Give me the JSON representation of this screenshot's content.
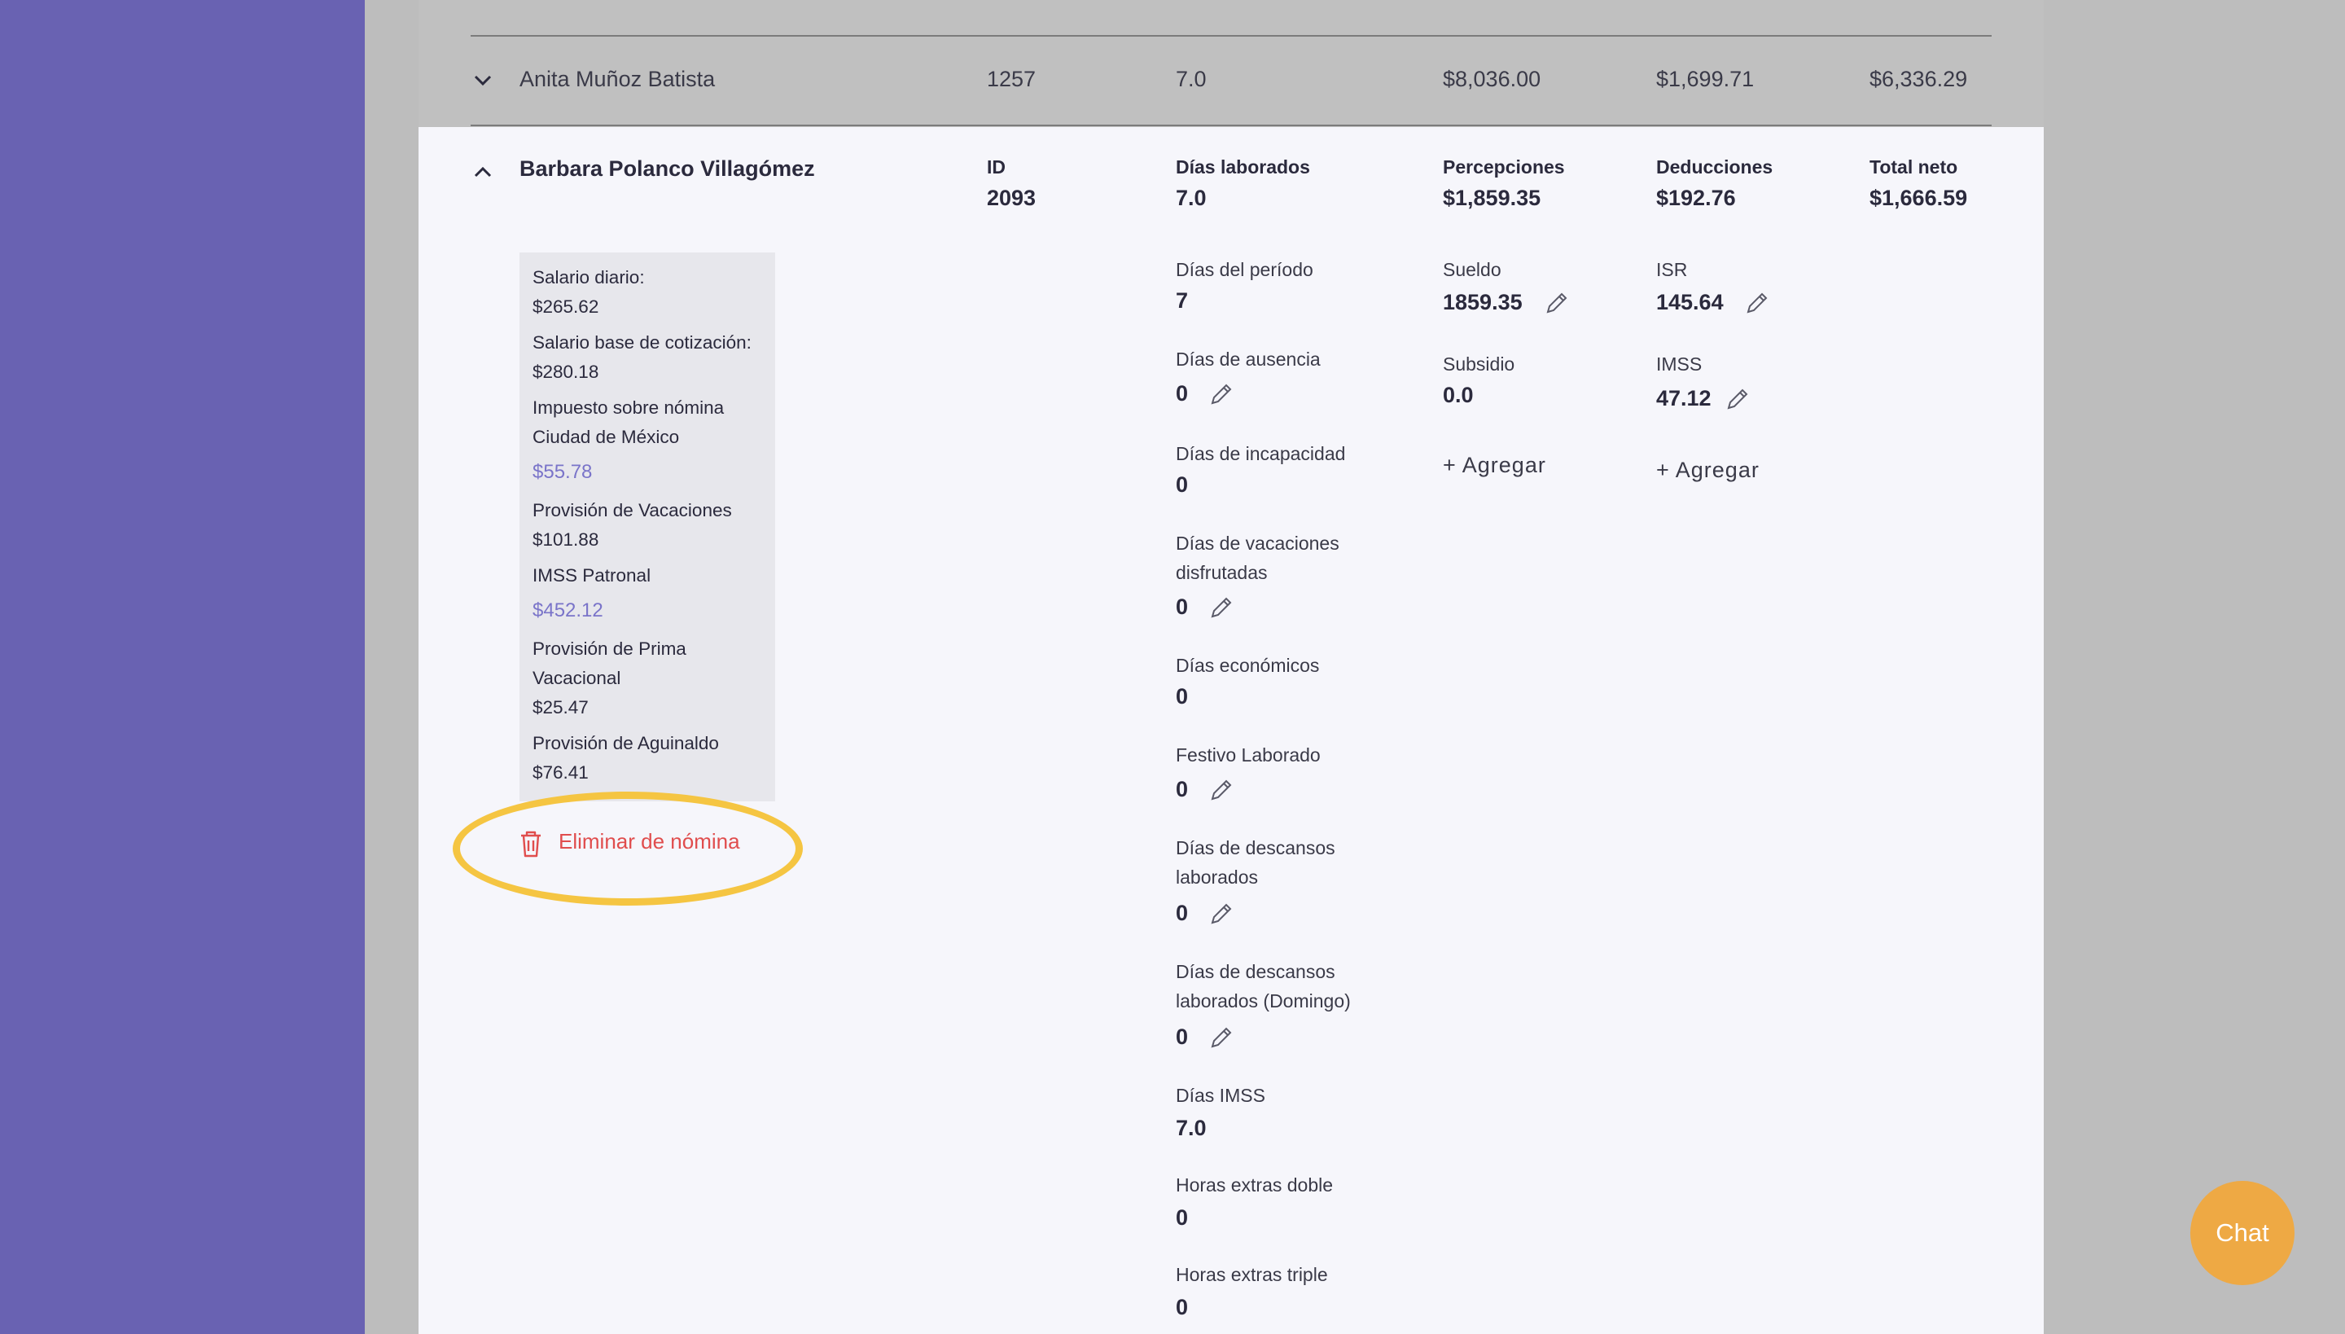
{
  "colors": {
    "sidebar": "#6962b2",
    "accent_link": "#7a74c9",
    "danger": "#e04d4d",
    "highlight": "#f5c542",
    "chat": "#eea944"
  },
  "collapsed_row": {
    "name": "Anita Muñoz Batista",
    "id": "1257",
    "days": "7.0",
    "perceptions": "$8,036.00",
    "deductions": "$1,699.71",
    "net": "$6,336.29",
    "icon": "chevron-down-icon"
  },
  "expanded_row": {
    "name": "Barbara Polanco Villagómez",
    "icon": "chevron-up-icon",
    "headers": {
      "id_label": "ID",
      "id_value": "2093",
      "days_label": "Días laborados",
      "days_value": "7.0",
      "perc_label": "Percepciones",
      "perc_value": "$1,859.35",
      "ded_label": "Deducciones",
      "ded_value": "$192.76",
      "net_label": "Total neto",
      "net_value": "$1,666.59"
    },
    "info": {
      "salario_diario_label": "Salario diario:",
      "salario_diario": "$265.62",
      "sbc_label": "Salario base de cotización:",
      "sbc": "$280.18",
      "isn_label_1": "Impuesto sobre nómina",
      "isn_label_2": "Ciudad de México",
      "isn": "$55.78",
      "vac_label": "Provisión de Vacaciones",
      "vac": "$101.88",
      "imss_label": "IMSS Patronal",
      "imss": "$452.12",
      "prima_label_1": "Provisión de Prima",
      "prima_label_2": "Vacacional",
      "prima": "$25.47",
      "aguinaldo_label": "Provisión de Aguinaldo",
      "aguinaldo": "$76.41"
    },
    "delete_label": "Eliminar de nómina",
    "days_fields": [
      {
        "label": "Días del período",
        "value": "7"
      },
      {
        "label": "Días de ausencia",
        "value": "0"
      },
      {
        "label": "Días de incapacidad",
        "value": "0"
      },
      {
        "label_1": "Días de vacaciones",
        "label_2": "disfrutadas",
        "value": "0"
      },
      {
        "label": "Días económicos",
        "value": "0"
      },
      {
        "label": "Festivo Laborado",
        "value": "0"
      },
      {
        "label_1": "Días de descansos",
        "label_2": "laborados",
        "value": "0"
      },
      {
        "label_1": "Días de descansos",
        "label_2": "laborados (Domingo)",
        "value": "0"
      },
      {
        "label": "Días IMSS",
        "value": "7.0"
      },
      {
        "label": "Horas extras doble",
        "value": "0"
      },
      {
        "label": "Horas extras triple",
        "value": "0"
      }
    ],
    "perceptions": [
      {
        "label": "Sueldo",
        "value": "1859.35"
      },
      {
        "label": "Subsidio",
        "value": "0.0"
      }
    ],
    "deductions": [
      {
        "label": "ISR",
        "value": "145.64"
      },
      {
        "label": "IMSS",
        "value": "47.12"
      }
    ],
    "add_label": "+ Agregar"
  },
  "chat_label": "Chat"
}
